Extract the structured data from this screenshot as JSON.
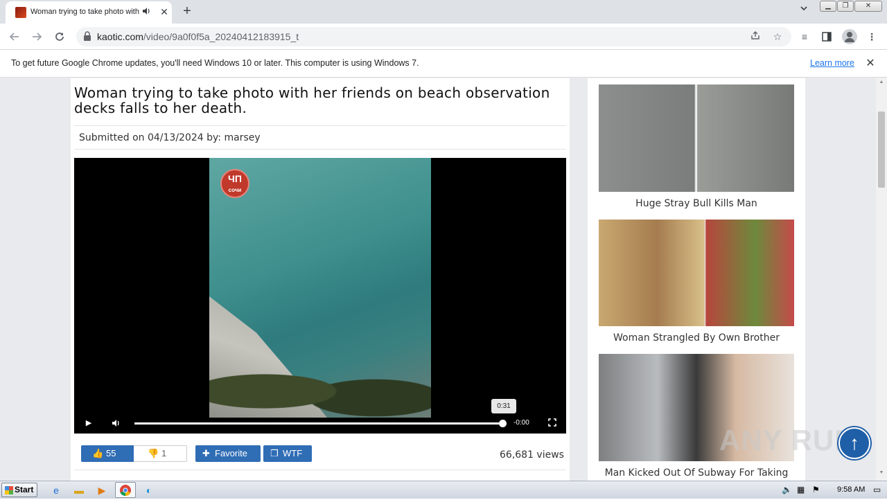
{
  "browser": {
    "tab_title": "Woman trying to take photo with",
    "new_tab_symbol": "+",
    "close_symbol": "✕",
    "url_host": "kaotic.com",
    "url_path": "/video/9a0f0f5a_20240412183915_t"
  },
  "infobar": {
    "message": "To get future Google Chrome updates, you'll need Windows 10 or later. This computer is using Windows 7.",
    "learn_more": "Learn more"
  },
  "video_page": {
    "title": "Woman trying to take photo with her friends on beach observation decks falls to her death.",
    "submitted_prefix": "Submitted on 04/13/2024 by:",
    "submitted_user": "marsey",
    "player": {
      "channel_logo_big": "ЧП",
      "channel_logo_small": "сочи",
      "hover_time": "0:31",
      "time_remaining": "-0:00",
      "progress": 0.99
    },
    "likes": "55",
    "dislikes": "1",
    "favorite_label": "Favorite",
    "wtf_label": "WTF",
    "views": "66,681 views"
  },
  "sidebar": {
    "cards": [
      {
        "title": "Huge Stray Bull Kills Man"
      },
      {
        "title": "Woman Strangled By Own Brother"
      },
      {
        "title": "Man Kicked Out Of Subway For Taking"
      }
    ]
  },
  "watermark": "ANY RUN",
  "taskbar": {
    "start_label": "Start",
    "clock": "9:58 AM"
  },
  "colors": {
    "accent_blue": "#2f6db5",
    "link_blue": "#1a73e8",
    "page_bg": "#e9eaed"
  }
}
